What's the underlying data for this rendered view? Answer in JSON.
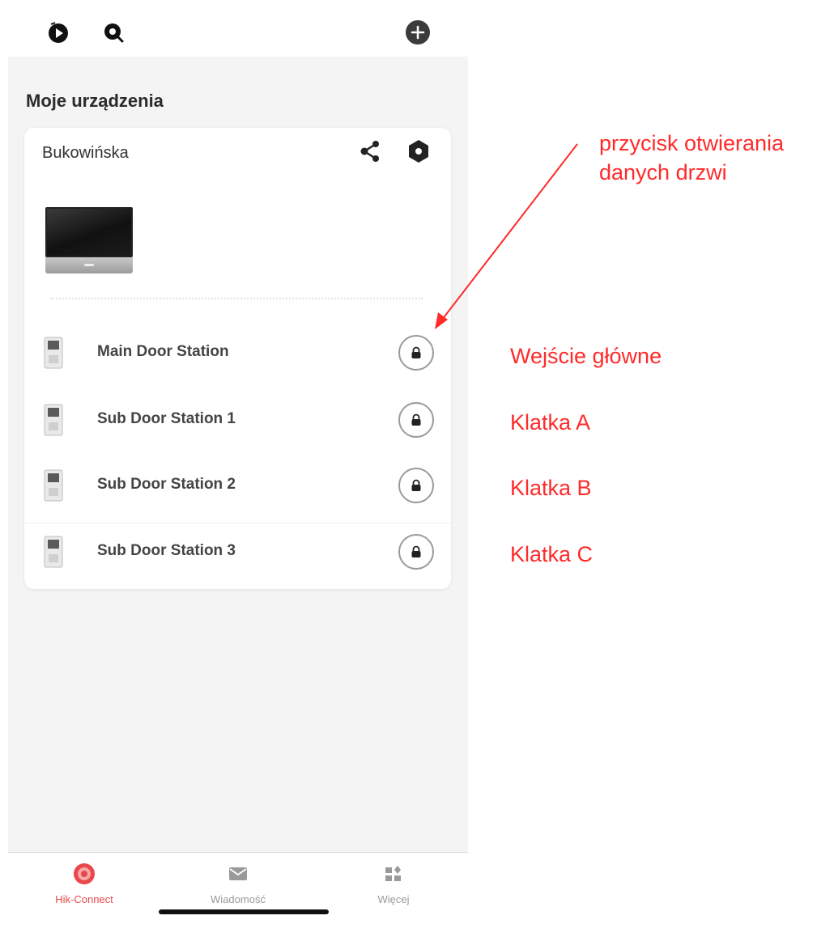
{
  "section": {
    "title": "Moje urządzenia"
  },
  "device": {
    "name": "Bukowińska",
    "doors": [
      {
        "name": "Main Door Station"
      },
      {
        "name": "Sub Door Station 1"
      },
      {
        "name": "Sub Door Station 2"
      },
      {
        "name": "Sub Door Station 3"
      }
    ]
  },
  "nav": {
    "items": [
      {
        "label": "Hik-Connect",
        "active": true
      },
      {
        "label": "Wiadomość",
        "active": false
      },
      {
        "label": "Więcej",
        "active": false
      }
    ]
  },
  "annotations": {
    "unlock_button_note": [
      "przycisk otwierania",
      "danych drzwi"
    ],
    "door_labels": [
      "Wejście główne",
      "Klatka A",
      "Klatka B",
      "Klatka C"
    ]
  },
  "colors": {
    "accent": "#e8484a",
    "annotation": "#ff2a2a"
  }
}
